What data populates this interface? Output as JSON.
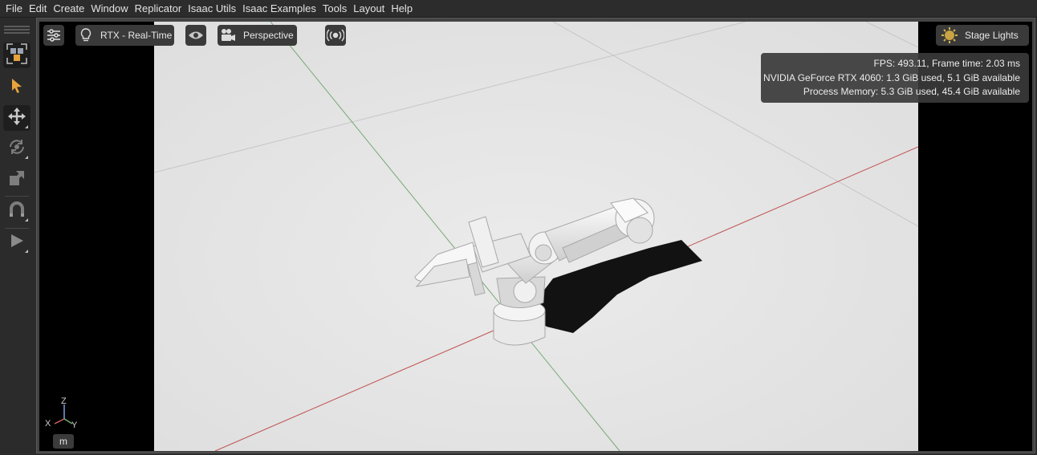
{
  "menu": [
    "File",
    "Edit",
    "Create",
    "Window",
    "Replicator",
    "Isaac Utils",
    "Isaac Examples",
    "Tools",
    "Layout",
    "Help"
  ],
  "toolbar": {
    "items": [
      "select-mode",
      "select-arrow",
      "move",
      "rotate",
      "scale",
      "snap",
      "play"
    ],
    "active_color": "#e8a33b"
  },
  "viewport": {
    "render_mode": "RTX - Real-Time",
    "camera": "Perspective",
    "lighting": "Stage Lights",
    "stats": [
      "FPS: 493.11, Frame time: 2.03 ms",
      "NVIDIA GeForce RTX 4060: 1.3 GiB used, 5.1 GiB available",
      "Process Memory: 5.3 GiB used, 45.4 GiB available"
    ],
    "unit": "m",
    "axes": {
      "x": "X",
      "y": "Y",
      "z": "Z"
    },
    "x_axis_color": "#c05050",
    "y_axis_color": "#78a878"
  }
}
